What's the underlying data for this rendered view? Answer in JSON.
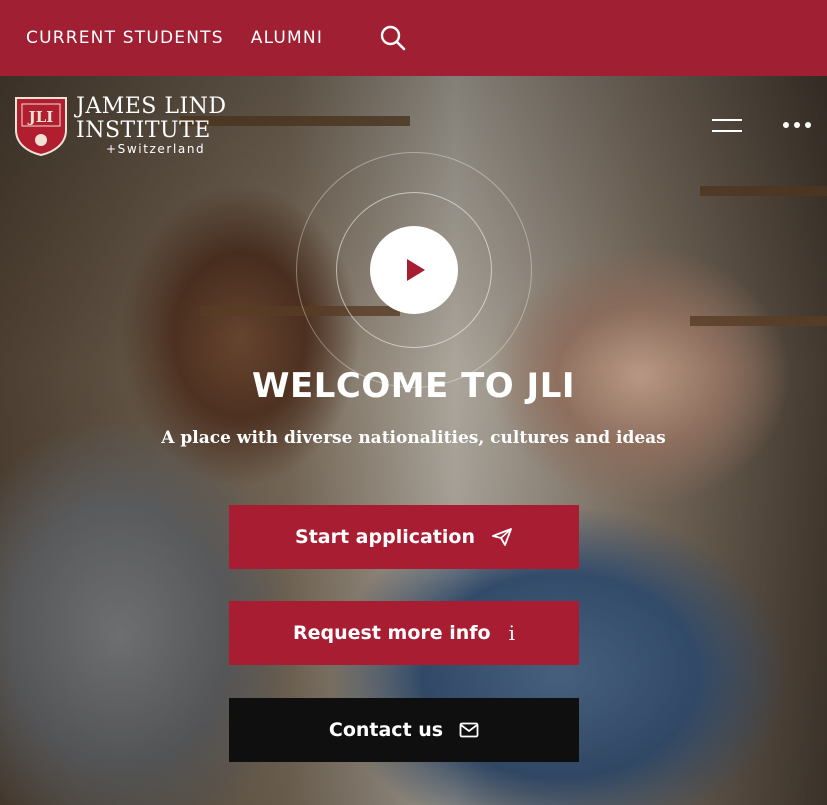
{
  "topbar": {
    "links": [
      "CURRENT STUDENTS",
      "ALUMNI"
    ],
    "search_icon": "search-icon",
    "background": "#a11f33"
  },
  "logo": {
    "line1": "JAMES LIND",
    "line2": "INSTITUTE",
    "line3": "Switzerland",
    "plus": "+",
    "shield_text": "JLI"
  },
  "hero": {
    "title": "WELCOME TO JLI",
    "subtitle": "A place with diverse nationalities, cultures and ideas",
    "play_icon": "play-icon"
  },
  "buttons": {
    "start": {
      "label": "Start application",
      "icon": "paper-plane-icon",
      "color": "#a91d33"
    },
    "request": {
      "label": "Request more info",
      "icon": "info-icon",
      "glyph": "i",
      "color": "#a91d33"
    },
    "contact": {
      "label": "Contact us",
      "icon": "envelope-icon",
      "color": "#0f0f0f"
    }
  },
  "header_icons": {
    "menu": "hamburger-menu-icon",
    "more": "more-dots-icon"
  }
}
